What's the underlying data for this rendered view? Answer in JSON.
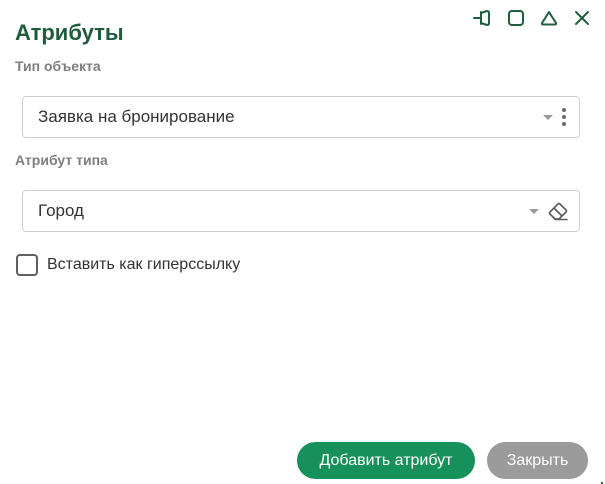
{
  "dialog": {
    "title": "Атрибуты"
  },
  "window_controls": {
    "icons": [
      "pin-icon",
      "maximize-icon",
      "collapse-icon",
      "close-icon"
    ]
  },
  "object_type": {
    "label": "Тип объекта",
    "value": "Заявка на бронирование"
  },
  "attribute_type": {
    "label": "Атрибут типа",
    "value": "Город"
  },
  "hyperlink_checkbox": {
    "label": "Вставить как гиперссылку",
    "checked": false
  },
  "buttons": {
    "add_label": "Добавить атрибут",
    "close_label": "Закрыть"
  },
  "colors": {
    "title": "#1f5d3c",
    "icon": "#1f5d3c",
    "primary": "#17915b",
    "secondary": "#9b9b9b",
    "label": "#7f7f7f",
    "border": "#cfcfcf"
  }
}
